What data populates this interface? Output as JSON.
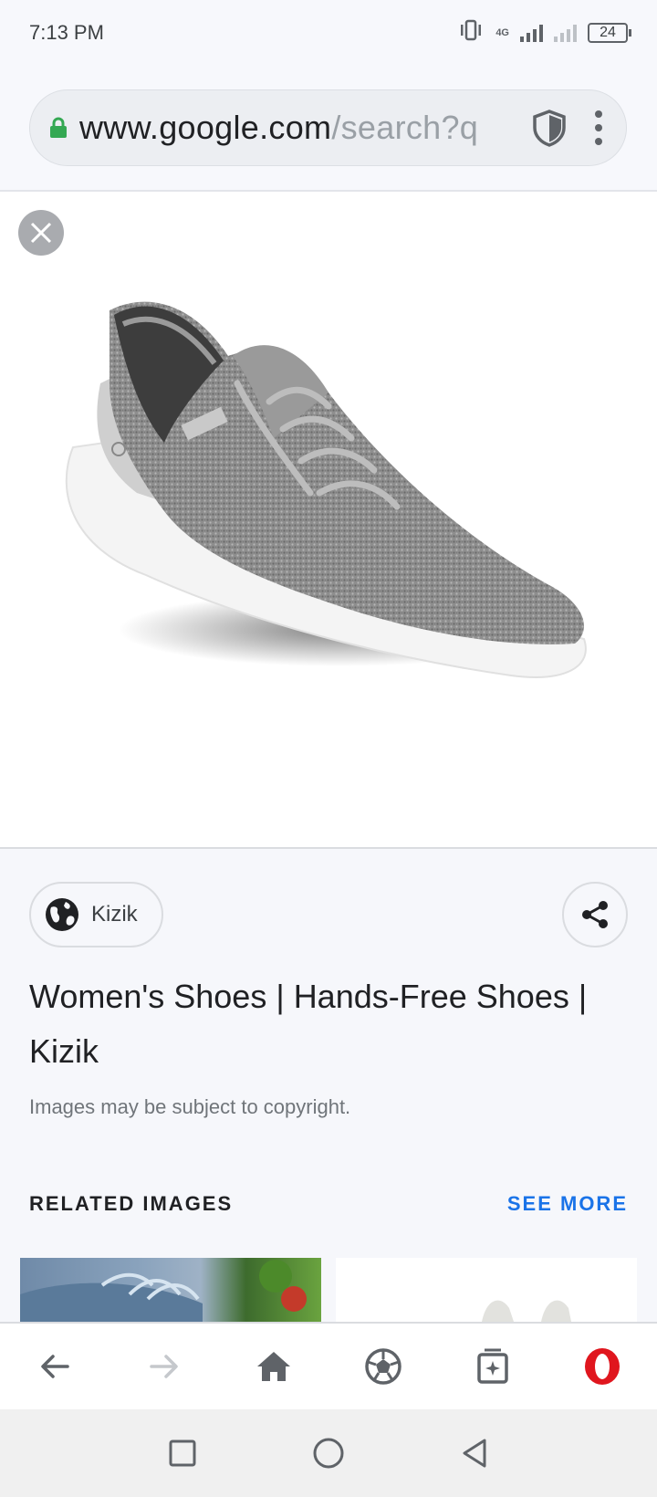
{
  "status_bar": {
    "time": "7:13 PM",
    "network": "4G",
    "battery": "24"
  },
  "url_bar": {
    "host": "www.google.com",
    "path": "/search?q",
    "secure": true
  },
  "viewer": {
    "close_label": "Close",
    "image_alt": "grey knit lace-up sneaker"
  },
  "info": {
    "source": "Kizik",
    "title": "Women's Shoes | Hands-Free Shoes | Kizik",
    "copyright": "Images may be subject to copyright."
  },
  "related": {
    "header": "RELATED IMAGES",
    "see_more": "SEE MORE"
  },
  "toolbar": {
    "items": [
      "back-icon",
      "forward-icon",
      "home-icon",
      "vpn-icon",
      "tabs-icon",
      "opera-menu-icon"
    ]
  },
  "colors": {
    "accent": "#1a73e8",
    "opera_red": "#e0161e",
    "lock_green": "#34a853"
  }
}
